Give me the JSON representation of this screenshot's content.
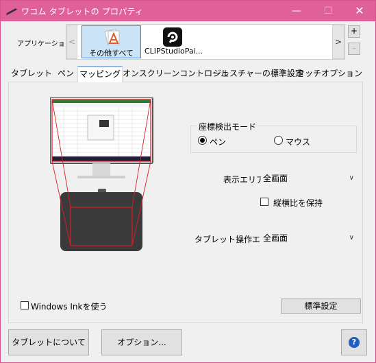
{
  "window": {
    "title": "ワコム タブレットの プロパティ",
    "controls": {
      "minimize": "—",
      "maximize": "☐",
      "close": "✕"
    }
  },
  "applications": {
    "label": "アプリケーション:",
    "prev": "<",
    "next": ">",
    "add": "+",
    "remove": "-",
    "items": [
      {
        "label": "その他すべて",
        "icon": "all-apps-icon",
        "selected": true
      },
      {
        "label": "CLIPStudioPai...",
        "icon": "clip-studio-icon",
        "selected": false
      }
    ]
  },
  "tabs": [
    {
      "label": "タブレット"
    },
    {
      "label": "ペン"
    },
    {
      "label": "マッピング",
      "active": true
    },
    {
      "label": "オンスクリーンコントロール"
    },
    {
      "label": "ジェスチャーの標準設定"
    },
    {
      "label": "タッチオプション"
    }
  ],
  "mapping": {
    "mode_group_title": "座標検出モード",
    "mode_pen": "ペン",
    "mode_mouse": "マウス",
    "mode_selected": "ペン",
    "display_area_label": "表示エリア:",
    "display_area_value": "全画面",
    "keep_aspect_label": "縦横比を保持",
    "tablet_area_label": "タブレット操作エリア:",
    "tablet_area_value": "全画面",
    "windows_ink_label": "Windows Inkを使う",
    "defaults_button": "標準設定"
  },
  "footer": {
    "about_button": "タブレットについて",
    "options_button": "オプション...",
    "help_icon": "?"
  },
  "colors": {
    "titlebar": "#e0609a",
    "mapping_lines": "#e01b24",
    "selected_app": "#cce4f7"
  }
}
